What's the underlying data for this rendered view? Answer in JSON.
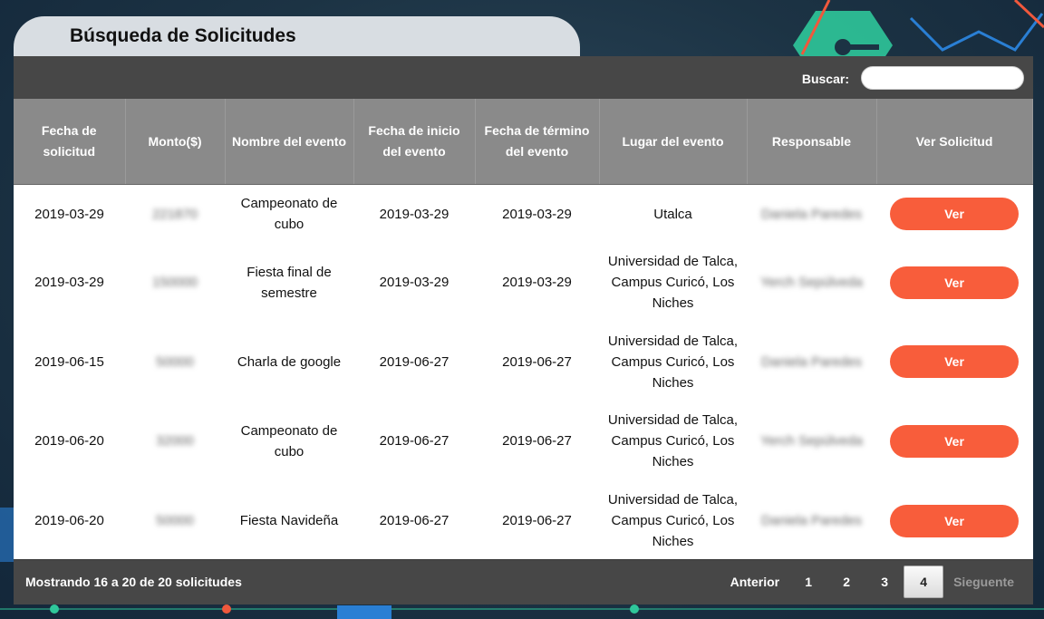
{
  "page": {
    "title": "Búsqueda de Solicitudes"
  },
  "search": {
    "label": "Buscar:",
    "value": ""
  },
  "table": {
    "headers": [
      "Fecha de solicitud",
      "Monto($)",
      "Nombre del evento",
      "Fecha de inicio del evento",
      "Fecha de término del evento",
      "Lugar del evento",
      "Responsable",
      "Ver Solicitud"
    ],
    "rows": [
      {
        "fecha": "2019-03-29",
        "monto": "221870",
        "nombre": "Campeonato de cubo",
        "inicio": "2019-03-29",
        "termino": "2019-03-29",
        "lugar": "Utalca",
        "responsable": "Daniela Paredes",
        "ver": "Ver"
      },
      {
        "fecha": "2019-03-29",
        "monto": "150000",
        "nombre": "Fiesta final de semestre",
        "inicio": "2019-03-29",
        "termino": "2019-03-29",
        "lugar": "Universidad de Talca, Campus Curicó, Los Niches",
        "responsable": "Yerch Sepúlveda",
        "ver": "Ver"
      },
      {
        "fecha": "2019-06-15",
        "monto": "50000",
        "nombre": "Charla de google",
        "inicio": "2019-06-27",
        "termino": "2019-06-27",
        "lugar": "Universidad de Talca, Campus Curicó, Los Niches",
        "responsable": "Daniela Paredes",
        "ver": "Ver"
      },
      {
        "fecha": "2019-06-20",
        "monto": "32000",
        "nombre": "Campeonato de cubo",
        "inicio": "2019-06-27",
        "termino": "2019-06-27",
        "lugar": "Universidad de Talca, Campus Curicó, Los Niches",
        "responsable": "Yerch Sepúlveda",
        "ver": "Ver"
      },
      {
        "fecha": "2019-06-20",
        "monto": "50000",
        "nombre": "Fiesta Navideña",
        "inicio": "2019-06-27",
        "termino": "2019-06-27",
        "lugar": "Universidad de Talca, Campus Curicó, Los Niches",
        "responsable": "Daniela Paredes",
        "ver": "Ver"
      }
    ]
  },
  "footer": {
    "info": "Mostrando 16 a 20 de 20 solicitudes",
    "prev": "Anterior",
    "pages": [
      "1",
      "2",
      "3",
      "4"
    ],
    "active_page": "4",
    "next": "Sieguente"
  },
  "colors": {
    "header_dark": "#474747",
    "header_gray": "#8a8a8a",
    "button": "#f85d3b"
  }
}
